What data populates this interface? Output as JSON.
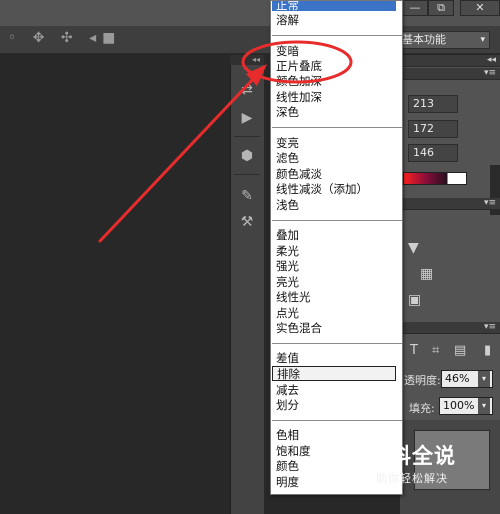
{
  "window": {
    "btn_minimize": "—",
    "btn_restore": "⧉",
    "btn_close": "✕"
  },
  "options_bar": {
    "workspace": "基本功能",
    "workspace_caret": "▾"
  },
  "blend_menu": {
    "groups": [
      [
        "正常",
        "溶解"
      ],
      [
        "变暗",
        "正片叠底",
        "颜色加深",
        "线性加深",
        "深色"
      ],
      [
        "变亮",
        "滤色",
        "颜色减淡",
        "线性减淡（添加）",
        "浅色"
      ],
      [
        "叠加",
        "柔光",
        "强光",
        "亮光",
        "线性光",
        "点光",
        "实色混合"
      ],
      [
        "差值",
        "排除",
        "减去",
        "划分"
      ],
      [
        "色相",
        "饱和度",
        "颜色",
        "明度"
      ]
    ],
    "selected_item": "正常",
    "hovered_item": "排除",
    "highlighted_item": "正片叠底"
  },
  "color_panel": {
    "r_value": "213",
    "g_value": "172",
    "b_value": "146"
  },
  "layers_panel": {
    "opacity_label": "透明度:",
    "opacity_value": "46%",
    "fill_label": "填充:",
    "fill_value": "100%"
  },
  "panel_collapse_glyph": "◂◂",
  "panel_menu_glyph": "▾≡",
  "annotation": {
    "ellipse_color": "#e82c2c",
    "arrow_color": "#e82c2c"
  },
  "watermark": {
    "title": "百科全说",
    "subtitle": "助你轻松解决"
  }
}
